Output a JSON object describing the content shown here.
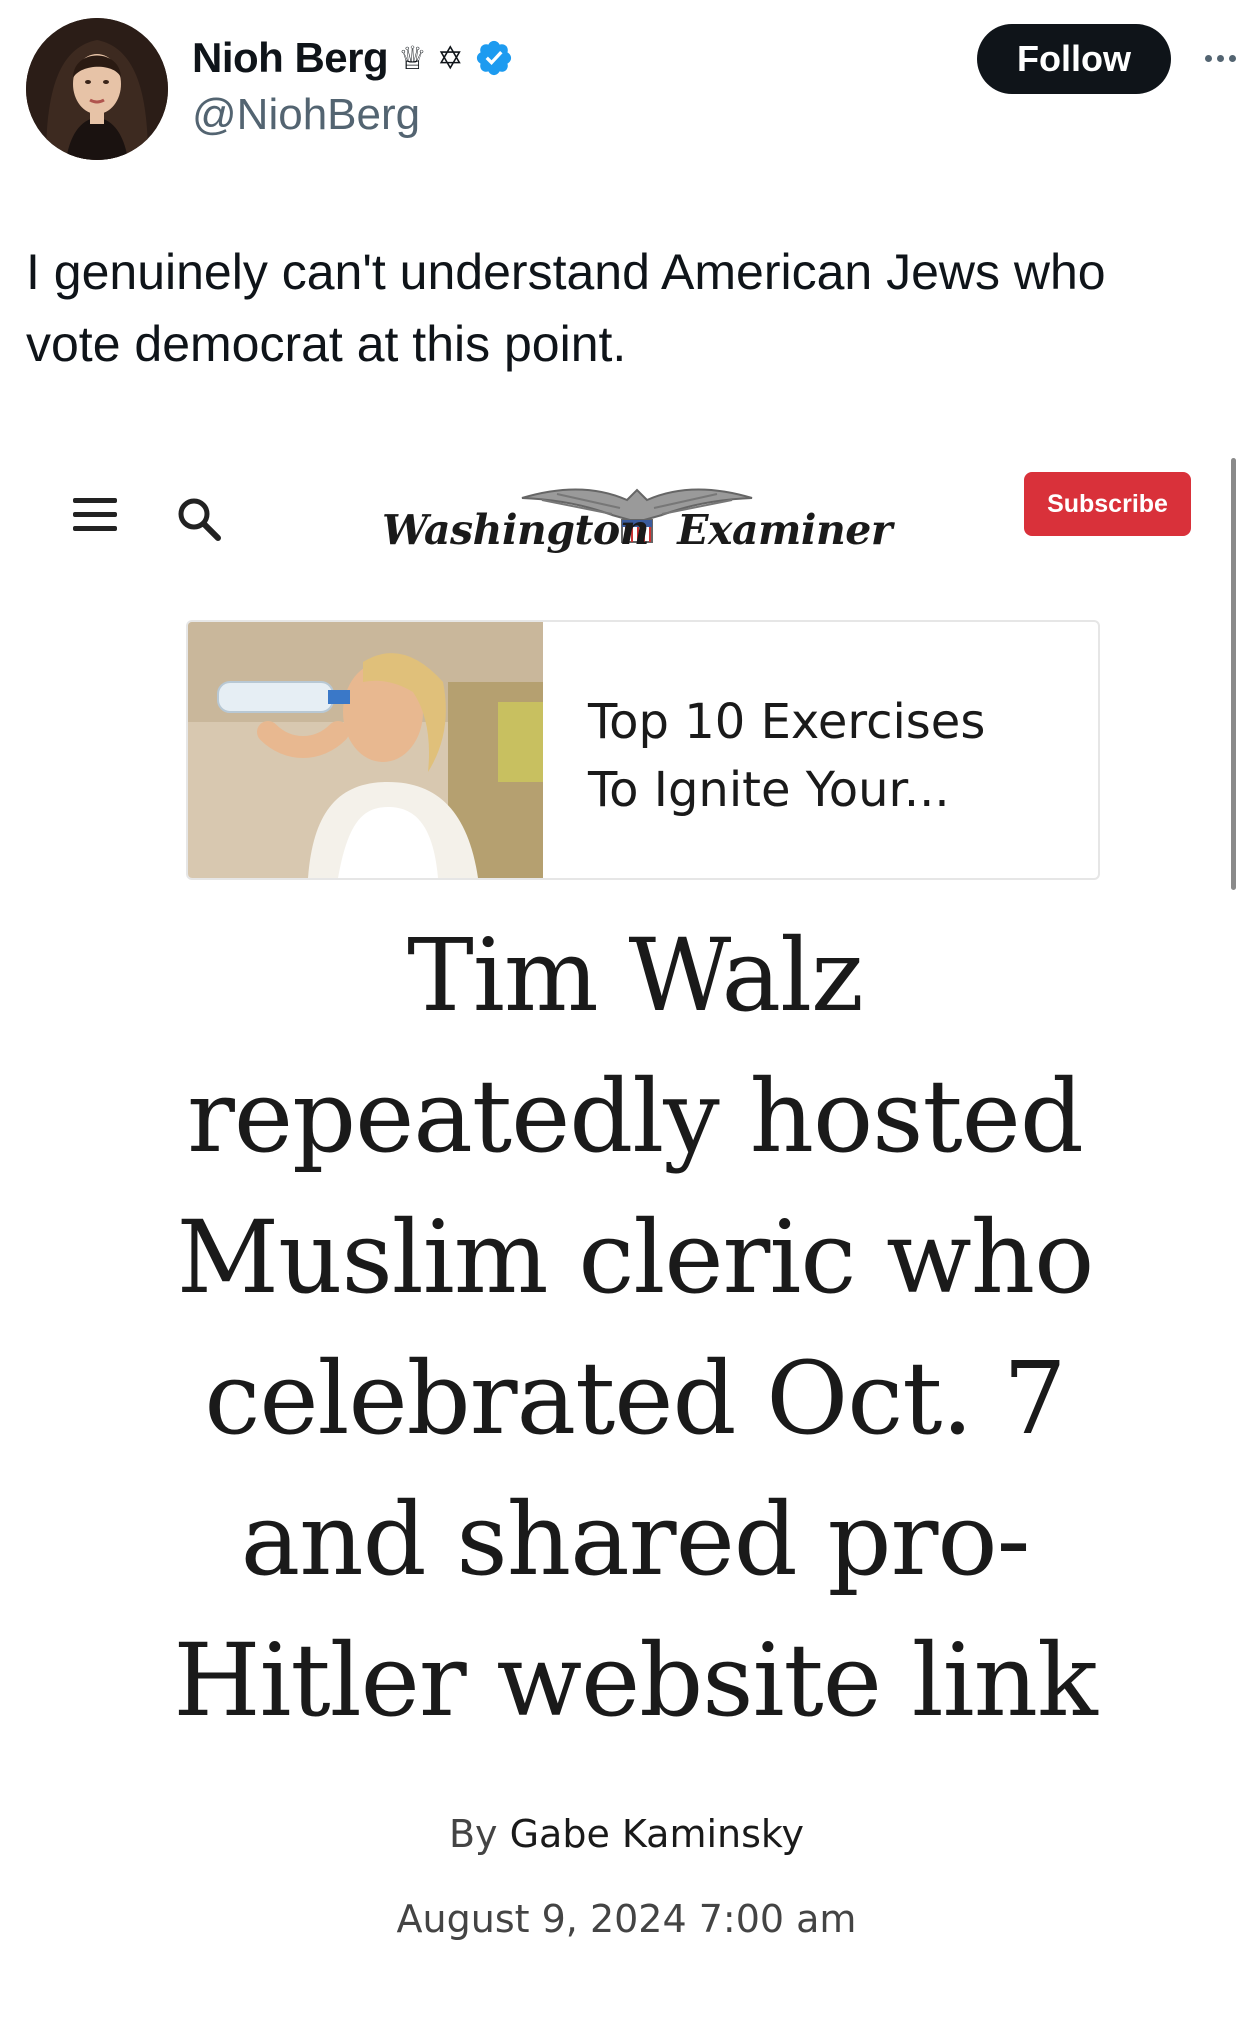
{
  "tweet": {
    "author": {
      "display_name": "Nioh Berg",
      "badges": [
        "♕",
        "✡"
      ],
      "handle": "@NiohBerg",
      "verified": true
    },
    "follow_label": "Follow",
    "text": "I genuinely can't understand American Jews who\nvote democrat at this point."
  },
  "article": {
    "publication": "Washington Examiner",
    "masthead_left": "Washington",
    "masthead_right": "Examiner",
    "subscribe_label": "Subscribe",
    "ad": {
      "title": "Top 10 Exercises\nTo Ignite Your..."
    },
    "headline": "Tim Walz\nrepeatedly hosted\nMuslim cleric who\ncelebrated Oct. 7\nand shared pro-\nHitler website link",
    "byline_prefix": "By",
    "author": "Gabe Kaminsky",
    "date": "August 9, 2024 7:00 am"
  },
  "colors": {
    "follow_bg": "#0f1419",
    "verified_blue": "#1d9bf0",
    "subscribe_red": "#d9313a",
    "handle_gray": "#536471"
  },
  "icons": [
    "verified-icon",
    "more-icon",
    "menu-icon",
    "search-icon",
    "eagle-icon"
  ]
}
